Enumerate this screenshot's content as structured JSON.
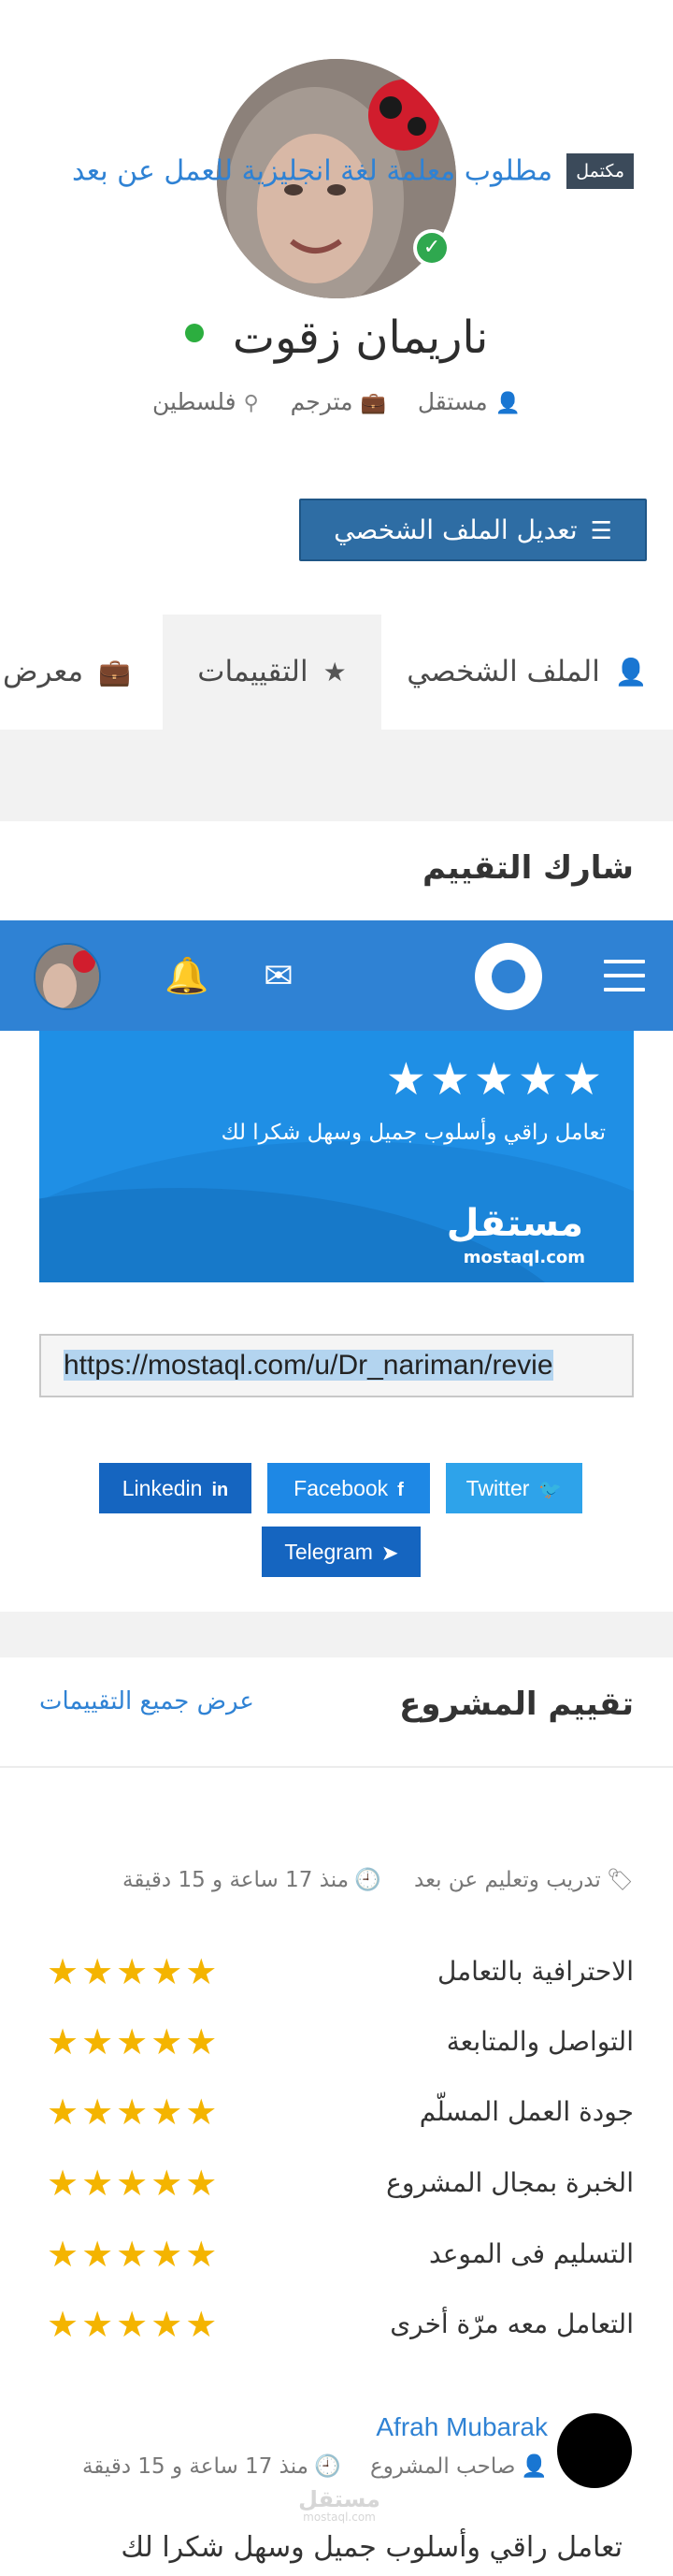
{
  "profile": {
    "name": "ناريمان زقوت",
    "meta": [
      {
        "icon": "user-icon",
        "label": "مستقل"
      },
      {
        "icon": "briefcase-icon",
        "label": "مترجم"
      },
      {
        "icon": "location-icon",
        "label": "فلسطين"
      }
    ],
    "edit_button": "تعديل الملف الشخصي"
  },
  "tabs": [
    {
      "icon": "user-icon",
      "label": "الملف الشخصي"
    },
    {
      "icon": "star-icon",
      "label": "التقييمات",
      "active": true
    },
    {
      "icon": "briefcase-icon",
      "label": "معرض ا"
    }
  ],
  "share": {
    "title": "شارك التقييم",
    "banner": {
      "stars": "★★★★★",
      "text": "تعامل راقي وأسلوب جميل وسهل شكرا لك",
      "logo_ar": "مستقل",
      "logo_en": "mostaql.com"
    },
    "url": "https://mostaql.com/u/Dr_nariman/revie",
    "buttons": {
      "twitter": "Twitter",
      "facebook": "Facebook",
      "linkedin": "Linkedin",
      "telegram": "Telegram"
    }
  },
  "header": {
    "icons": [
      "menu-icon",
      "logo-icon",
      "mail-icon",
      "bell-icon",
      "avatar"
    ]
  },
  "project_review": {
    "title": "تقييم المشروع",
    "all_reviews_link": "عرض جميع التقييمات",
    "badge": "مكتمل",
    "project_title": "مطلوب معلمة لغة انجليزية للعمل عن بعد",
    "category": "تدريب وتعليم عن بعد",
    "time": "منذ 17 ساعة و 15 دقيقة",
    "criteria": [
      {
        "label": "الاحترافية بالتعامل",
        "rating": 5
      },
      {
        "label": "التواصل والمتابعة",
        "rating": 5
      },
      {
        "label": "جودة العمل المسلّم",
        "rating": 5
      },
      {
        "label": "الخبرة بمجال المشروع",
        "rating": 5
      },
      {
        "label": "التسليم فى الموعد",
        "rating": 5
      },
      {
        "label": "التعامل معه مرّة أخرى",
        "rating": 5
      }
    ],
    "stars_display": "★★★★★",
    "reviewer": {
      "name": "Afrah Mubarak",
      "role": "صاحب المشروع",
      "time": "منذ 17 ساعة و 15 دقيقة"
    },
    "watermark": {
      "ar": "مستقل",
      "en": "mostaql.com"
    },
    "review_text": "تعامل راقي وأسلوب جميل وسهل شكرا لك"
  },
  "colors": {
    "brand_blue": "#2f82d4",
    "edit_button": "#2e6da4",
    "star_gold": "#f4b400",
    "online_green": "#2cae3f"
  }
}
